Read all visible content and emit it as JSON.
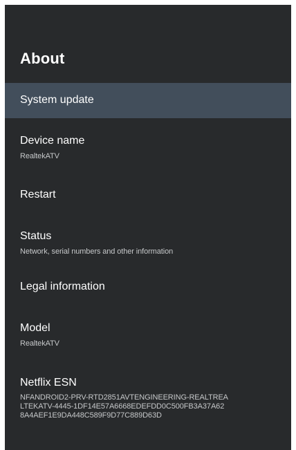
{
  "page": {
    "title": "About"
  },
  "items": [
    {
      "title": "System update",
      "subtitle": ""
    },
    {
      "title": "Device name",
      "subtitle": "RealtekATV"
    },
    {
      "title": "Restart",
      "subtitle": ""
    },
    {
      "title": "Status",
      "subtitle": "Network, serial numbers and other information"
    },
    {
      "title": "Legal information",
      "subtitle": ""
    },
    {
      "title": "Model",
      "subtitle": "RealtekATV"
    },
    {
      "title": "Netflix ESN",
      "subtitle": "NFANDROID2-PRV-RTD2851AVTENGINEERING-REALTREA\nLTEKATV-4445-1DF14E57A6668EDEFDD0C500FB3A37A62\n8A4AEF1E9DA448C589F9D77C889D63D"
    }
  ],
  "colors": {
    "background": "#282a2c",
    "selected_row": "#424e5b",
    "primary_text": "#ffffff",
    "secondary_text": "#c6c8ca"
  }
}
